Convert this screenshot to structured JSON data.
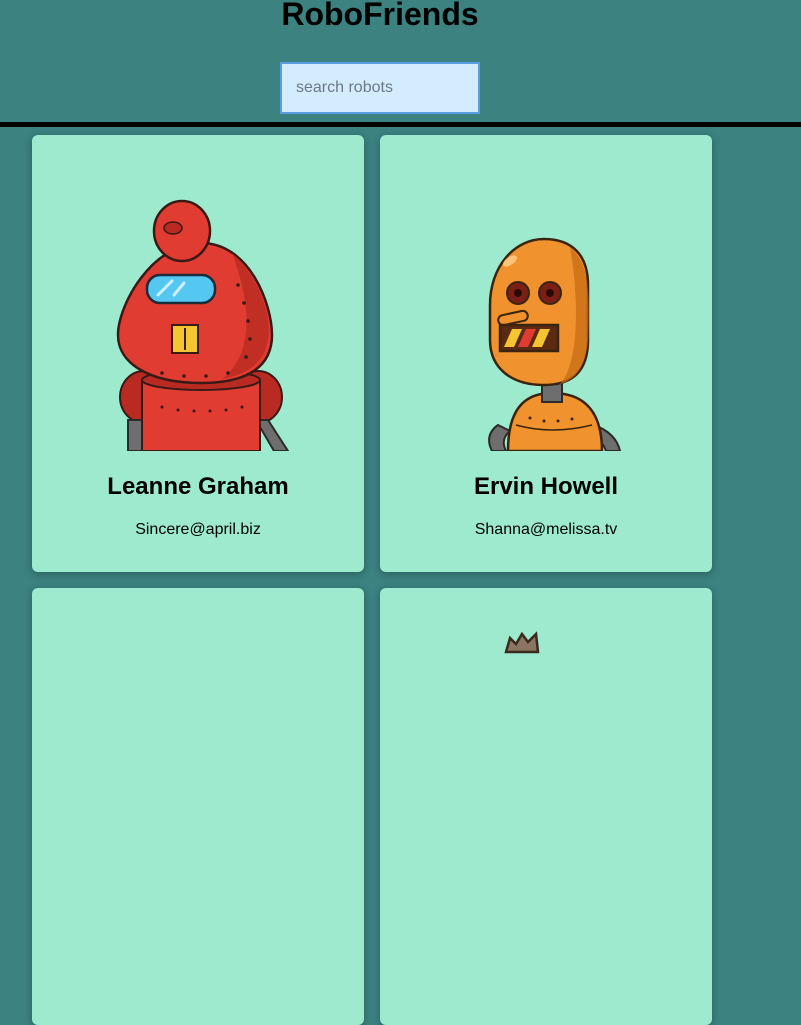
{
  "app": {
    "title": "RoboFriends"
  },
  "search": {
    "placeholder": "search robots",
    "value": ""
  },
  "colors": {
    "background": "#3b8280",
    "card": "#9eeacf",
    "search_bg": "#d3ecff",
    "search_border": "#5b9be0"
  },
  "robots": [
    {
      "name": "Leanne Graham",
      "email": "Sincere@april.biz",
      "image": "red-robot-avatar"
    },
    {
      "name": "Ervin Howell",
      "email": "Shanna@melissa.tv",
      "image": "orange-robot-avatar"
    },
    {
      "name": "",
      "email": "",
      "image": "robot-avatar"
    },
    {
      "name": "",
      "email": "",
      "image": "robot-avatar"
    }
  ]
}
